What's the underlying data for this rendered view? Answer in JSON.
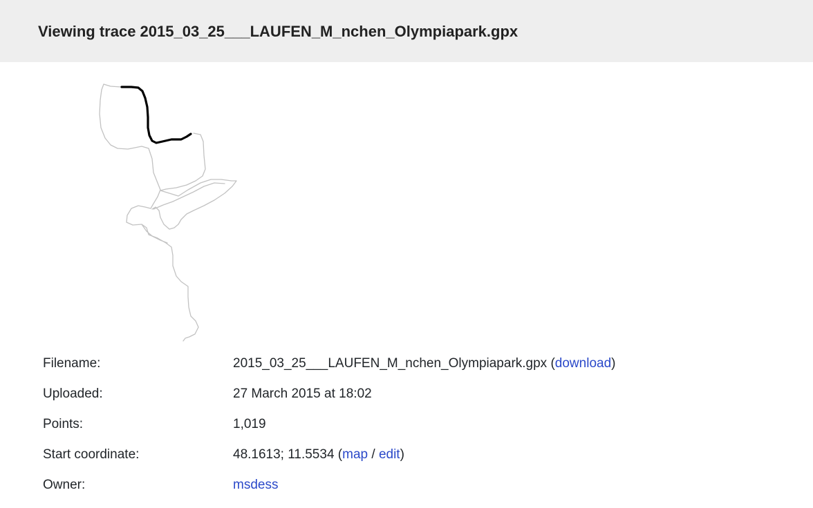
{
  "page": {
    "title": "Viewing trace 2015_03_25___LAUFEN_M_nchen_Olympiapark.gpx"
  },
  "trace": {
    "colors": {
      "full_route": "#c2c2c2",
      "highlight": "#000000",
      "link": "#2b49c9",
      "header_bg": "#eeeeee"
    }
  },
  "details": {
    "filename_label": "Filename:",
    "filename_value": "2015_03_25___LAUFEN_M_nchen_Olympiapark.gpx",
    "download_link": "download",
    "uploaded_label": "Uploaded:",
    "uploaded_value": "27 March 2015 at 18:02",
    "points_label": "Points:",
    "points_value": "1,019",
    "start_label": "Start coordinate:",
    "start_value": "48.1613; 11.5534",
    "map_link": "map",
    "link_separator": "/",
    "edit_link": "edit",
    "owner_label": "Owner:",
    "owner_value": "msdess"
  }
}
